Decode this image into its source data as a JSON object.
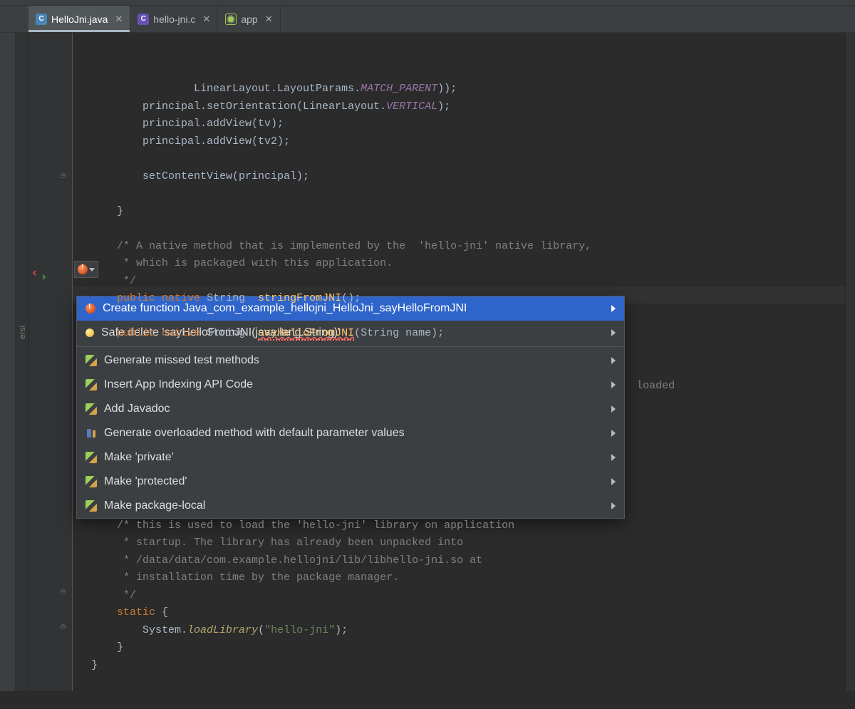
{
  "tabs": [
    {
      "label": "HelloJni.java",
      "icon": "C",
      "active": true
    },
    {
      "label": "hello-jni.c",
      "icon": "C",
      "active": false
    },
    {
      "label": "app",
      "icon": "app",
      "active": false
    }
  ],
  "left_tool_label": "ersi",
  "code": {
    "l1a": "LinearLayout.LayoutParams.",
    "l1b": "MATCH_PARENT",
    "l1c": "));",
    "l2a": "principal.setOrientation(LinearLayout.",
    "l2b": "VERTICAL",
    "l2c": ");",
    "l3": "principal.addView(tv);",
    "l4": "principal.addView(tv2);",
    "l6": "setContentView(principal);",
    "l8": "}",
    "c1": "/* A native method that is implemented by the  'hello-jni' native library,",
    "c2": " * which is packaged with this application.",
    "c3": " */",
    "dcl1a": "public",
    "dcl1b": "native",
    "dcl1c": "String  ",
    "dcl1d": "stringFromJNI",
    "dcl1e": "();",
    "dcl2a": "public",
    "dcl2b": "native",
    "dcl2c": "String  ",
    "dcl2d": "sayHelloFromJNI",
    "dcl2e": "(String name);",
    "hidden_loaded": "loaded",
    "c10": "/* this is used to load the 'hello-jni' library on application",
    "c11": " * startup. The library has already been unpacked into",
    "c12": " * /data/data/com.example.hellojni/lib/libhello-jni.so at",
    "c13": " * installation time by the package manager.",
    "c14": " */",
    "st_a": "static",
    "st_b": " {",
    "ll_a": "System.",
    "ll_b": "loadLibrary",
    "ll_c": "(",
    "ll_d": "\"hello-jni\"",
    "ll_e": ");",
    "cb1": "}",
    "cb2": "}"
  },
  "popup": {
    "items": [
      {
        "icon": "bulb-red",
        "label": "Create function Java_com_example_hellojni_HelloJni_sayHelloFromJNI",
        "sub": true,
        "sel": true
      },
      {
        "icon": "bulb-yel",
        "label": "Safe delete 'sayHelloFromJNI(java.lang.String)'",
        "sub": true
      },
      {
        "sep": true
      },
      {
        "icon": "pencil",
        "label": "Generate missed test methods",
        "sub": true
      },
      {
        "icon": "pencil",
        "label": "Insert App Indexing API Code",
        "sub": true
      },
      {
        "icon": "pencil",
        "label": "Add Javadoc",
        "sub": true
      },
      {
        "icon": "refactor",
        "label": "Generate overloaded method with default parameter values",
        "sub": true
      },
      {
        "icon": "pencil",
        "label": "Make 'private'",
        "sub": true
      },
      {
        "icon": "pencil",
        "label": "Make 'protected'",
        "sub": true
      },
      {
        "icon": "pencil",
        "label": "Make package-local",
        "sub": true
      }
    ]
  }
}
